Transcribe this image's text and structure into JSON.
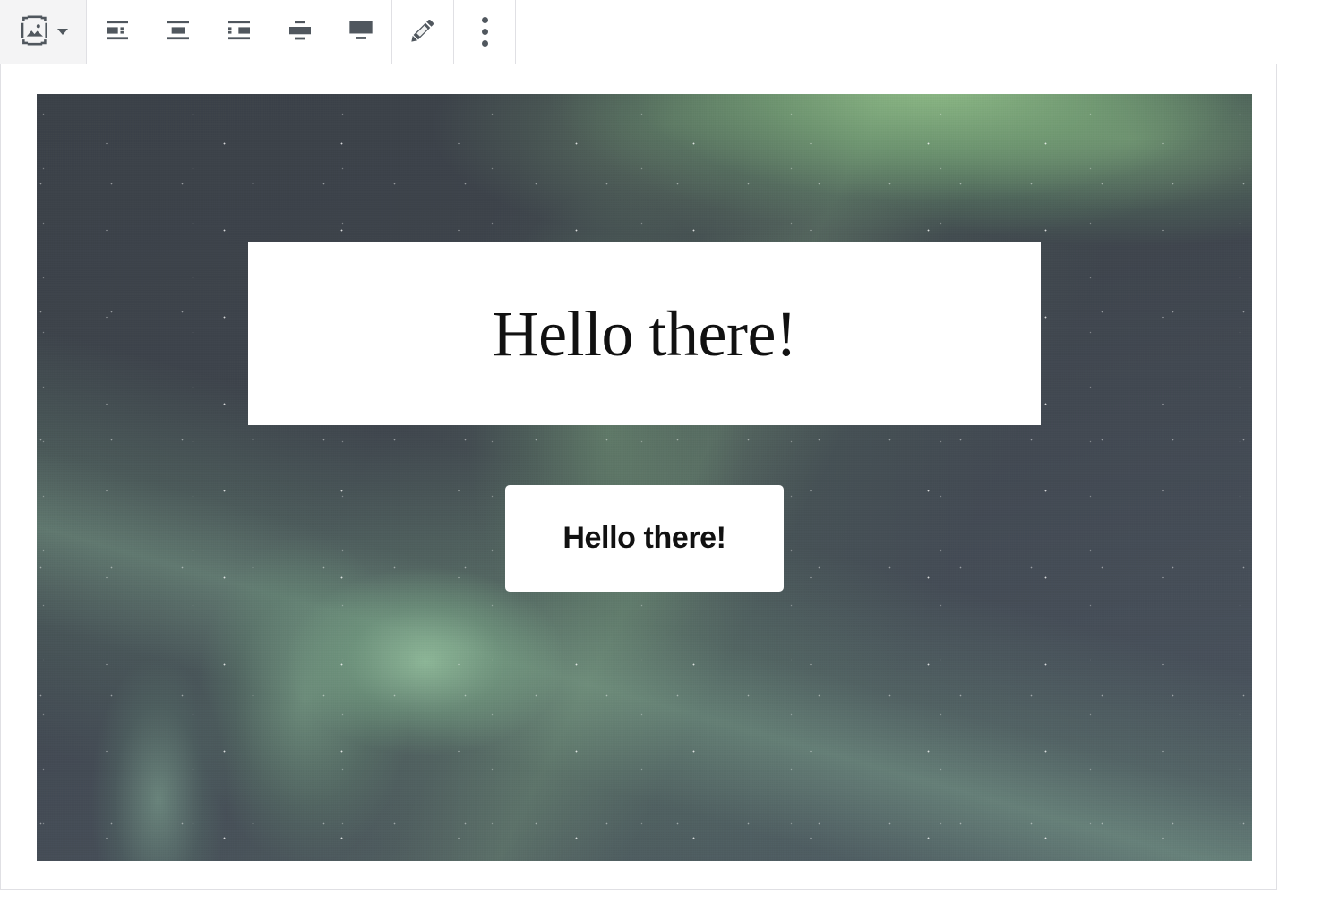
{
  "toolbar": {
    "block_type": {
      "name": "Cover",
      "icon": "cover-block-icon",
      "dropdown_icon": "chevron-down-icon"
    },
    "alignment_buttons": [
      {
        "label": "Align left",
        "icon": "align-left-icon"
      },
      {
        "label": "Align center",
        "icon": "align-center-icon"
      },
      {
        "label": "Align right",
        "icon": "align-right-icon"
      },
      {
        "label": "Wide width",
        "icon": "align-wide-icon"
      },
      {
        "label": "Full width",
        "icon": "align-full-icon"
      }
    ],
    "edit_button": {
      "label": "Edit",
      "icon": "pencil-icon"
    },
    "options_button": {
      "label": "Options",
      "icon": "kebab-menu-icon"
    }
  },
  "cover_block": {
    "background": {
      "alt": "Green aurora borealis over a dark starry night sky",
      "sky_color": "#3e444c",
      "aurora_color": "#96c68c"
    },
    "heading": {
      "text": "Hello there!",
      "panel_background": "#ffffff",
      "text_color": "#111111"
    },
    "button": {
      "text": "Hello there!",
      "background": "#ffffff",
      "text_color": "#111111"
    }
  },
  "colors": {
    "toolbar_icon": "#50575e",
    "border": "#e0e0e4",
    "canvas": "#ffffff"
  }
}
